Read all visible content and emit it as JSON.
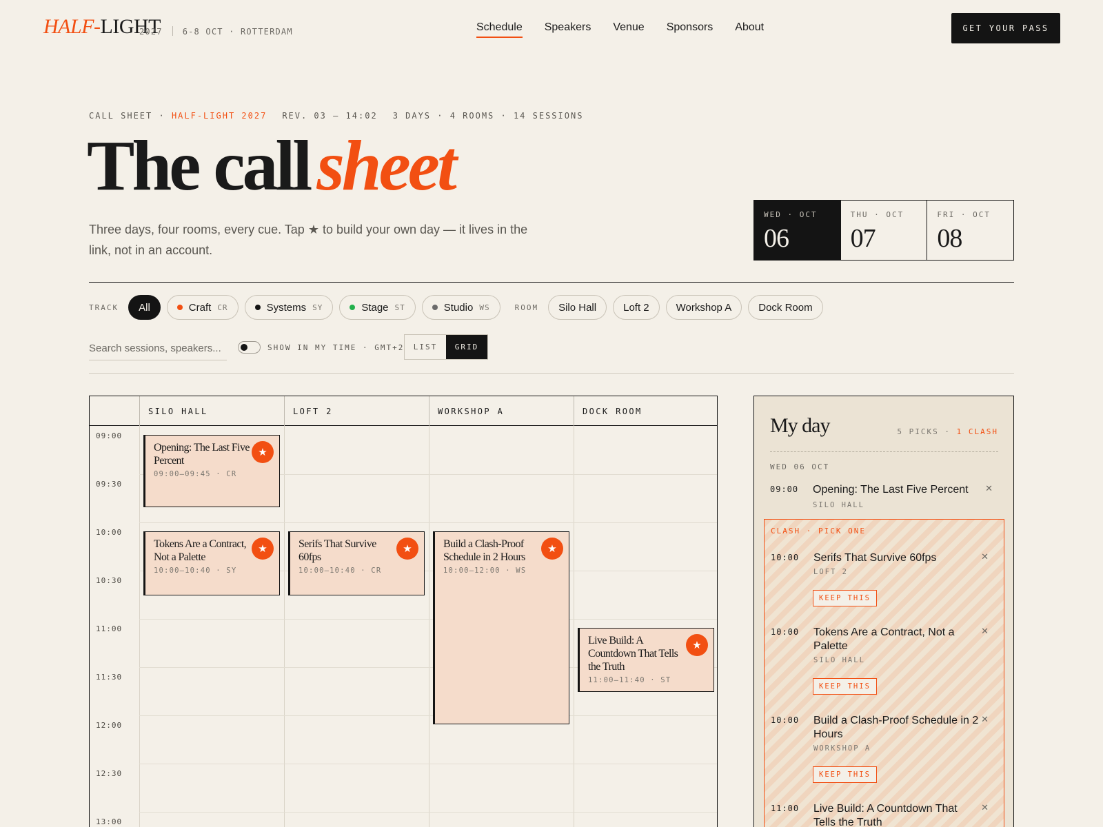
{
  "brand": {
    "logo_accent": "HALF-",
    "logo_rest": "LIGHT",
    "year": "2027",
    "meta": "6-8 OCT · ROTTERDAM"
  },
  "nav": {
    "items": [
      "Schedule",
      "Speakers",
      "Venue",
      "Sponsors",
      "About"
    ],
    "active": "Schedule"
  },
  "cta": {
    "label": "GET YOUR PASS"
  },
  "kicker": {
    "prefix": "CALL SHEET ·",
    "event": "HALF-LIGHT 2027",
    "rev": "REV. 03 — 14:02",
    "stats": "3 DAYS · 4 ROOMS · 14 SESSIONS"
  },
  "hero": {
    "title_plain": "The call",
    "title_accent": "sheet",
    "lede": "Three days, four rooms, every cue. Tap ★ to build your own day — it lives in the link, not in an account."
  },
  "days": [
    {
      "label": "WED · OCT",
      "num": "06",
      "active": true
    },
    {
      "label": "THU · OCT",
      "num": "07",
      "active": false
    },
    {
      "label": "FRI · OCT",
      "num": "08",
      "active": false
    }
  ],
  "filters": {
    "track_label": "TRACK",
    "tracks": [
      {
        "label": "All",
        "code": "",
        "color": "",
        "active": true
      },
      {
        "label": "Craft",
        "code": "CR",
        "color": "#f24f12",
        "active": false
      },
      {
        "label": "Systems",
        "code": "SY",
        "color": "#141414",
        "active": false
      },
      {
        "label": "Stage",
        "code": "ST",
        "color": "#22b04b",
        "active": false
      },
      {
        "label": "Studio",
        "code": "WS",
        "color": "#6b6b6b",
        "active": false
      }
    ],
    "room_label": "ROOM",
    "rooms": [
      "Silo Hall",
      "Loft 2",
      "Workshop A",
      "Dock Room"
    ]
  },
  "controls": {
    "search_placeholder": "Search sessions, speakers...",
    "toggle_label": "SHOW IN MY TIME · GMT+2",
    "view_list": "LIST",
    "view_grid": "GRID",
    "active_view": "GRID"
  },
  "grid": {
    "rooms": [
      "SILO HALL",
      "LOFT 2",
      "WORKSHOP A",
      "DOCK ROOM"
    ],
    "times": [
      "09:00",
      "09:30",
      "10:00",
      "10:30",
      "11:00",
      "11:30",
      "12:00",
      "12:30",
      "13:00"
    ],
    "sessions": [
      {
        "title": "Opening: The Last Five Percent",
        "meta": "09:00–09:45 · CR",
        "room": 0,
        "start": "09:00",
        "end": "09:45",
        "starred": true
      },
      {
        "title": "Tokens Are a Contract, Not a Palette",
        "meta": "10:00–10:40 · SY",
        "room": 0,
        "start": "10:00",
        "end": "10:40",
        "starred": true
      },
      {
        "title": "Serifs That Survive 60fps",
        "meta": "10:00–10:40 · CR",
        "room": 1,
        "start": "10:00",
        "end": "10:40",
        "starred": true
      },
      {
        "title": "Build a Clash-Proof Schedule in 2 Hours",
        "meta": "10:00–12:00 · WS",
        "room": 2,
        "start": "10:00",
        "end": "12:00",
        "starred": true
      },
      {
        "title": "Live Build: A Countdown That Tells the Truth",
        "meta": "11:00–11:40 · ST",
        "room": 3,
        "start": "11:00",
        "end": "11:40",
        "starred": true
      }
    ]
  },
  "myday": {
    "title": "My day",
    "picks": "5 PICKS ·",
    "clash": "1 CLASH",
    "date": "WED 06 OCT",
    "first": {
      "time": "09:00",
      "name": "Opening: The Last Five Percent",
      "room": "SILO HALL"
    },
    "clash_label": "CLASH · PICK ONE",
    "keep_label": "KEEP THIS",
    "clash_items": [
      {
        "time": "10:00",
        "name": "Serifs That Survive 60fps",
        "room": "LOFT 2"
      },
      {
        "time": "10:00",
        "name": "Tokens Are a Contract, Not a Palette",
        "room": "SILO HALL"
      },
      {
        "time": "10:00",
        "name": "Build a Clash-Proof Schedule in 2 Hours",
        "room": "WORKSHOP A"
      },
      {
        "time": "11:00",
        "name": "Live Build: A Countdown That Tells the Truth",
        "room": ""
      }
    ]
  },
  "colors": {
    "accent": "#f24f12",
    "ink": "#141414",
    "paper": "#f4f0e8",
    "session_fill": "#f5dccb"
  }
}
